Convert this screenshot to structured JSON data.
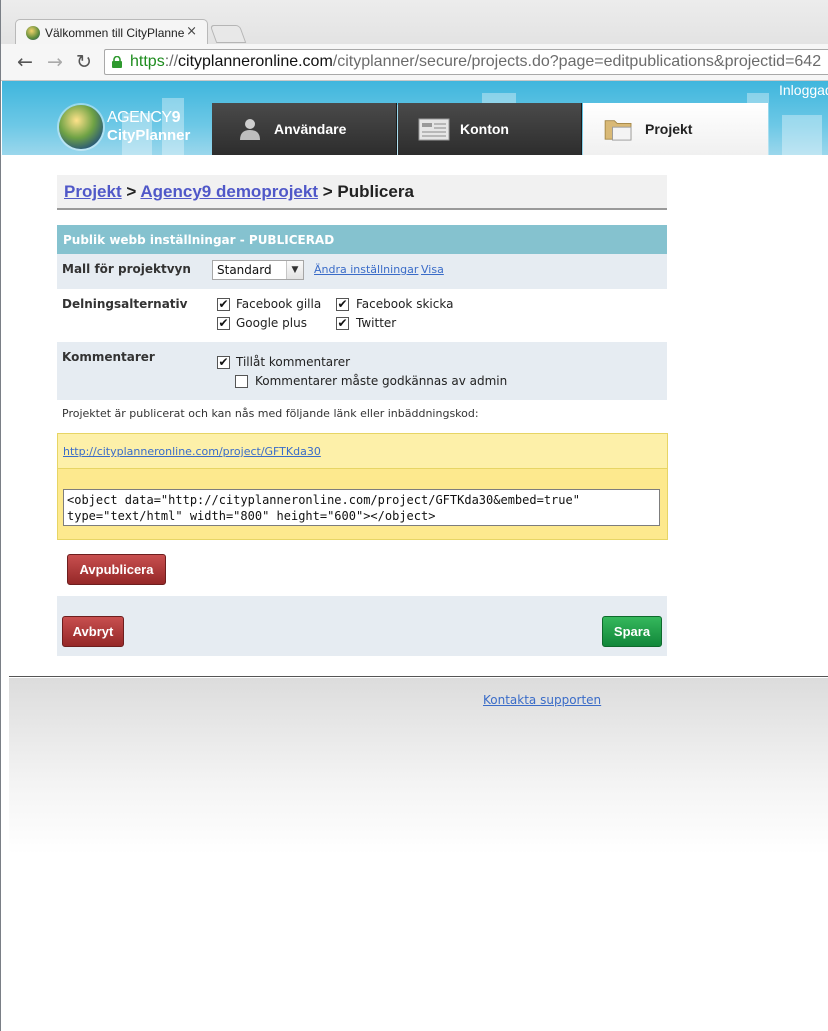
{
  "browser": {
    "tab_title": "Välkommen till CityPlanne",
    "tab_close": "×",
    "url_scheme": "https",
    "url_sep": "://",
    "url_host": "cityplanneronline.com",
    "url_path": "/cityplanner/secure/projects.do?page=editpublications&projectid=642",
    "back": "←",
    "forward": "→",
    "reload": "↻"
  },
  "header": {
    "logged_in": "Inloggad",
    "logo_line1_a": "AGENCY",
    "logo_line1_b": "9",
    "logo_line2": "CityPlanner",
    "tabs": [
      {
        "label": "Användare",
        "icon": "user-icon"
      },
      {
        "label": "Konton",
        "icon": "accounts-icon"
      },
      {
        "label": "Projekt",
        "icon": "folder-icon",
        "active": true
      }
    ]
  },
  "breadcrumb": {
    "item1": "Projekt",
    "sep": " > ",
    "item2": "Agency9 demoprojekt",
    "current": "Publicera"
  },
  "settings": {
    "title": "Publik webb inställningar - PUBLICERAD",
    "template_label": "Mall för projektvyn",
    "template_value": "Standard",
    "template_arrow": "▼",
    "change_settings_link": "Ändra inställningar",
    "view_link": "Visa",
    "sharing_label": "Delningsalternativ",
    "sharing": [
      {
        "label": "Facebook gilla",
        "checked": true
      },
      {
        "label": "Facebook skicka",
        "checked": true
      },
      {
        "label": "Google plus",
        "checked": true
      },
      {
        "label": "Twitter",
        "checked": true
      }
    ],
    "comments_label": "Kommentarer",
    "allow_comments": "Tillåt kommentarer",
    "approve_comments": "Kommentarer måste godkännas av admin",
    "checkmark": "✔"
  },
  "publish": {
    "info": "Projektet är publicerat och kan nås med följande länk eller inbäddningskod:",
    "link": "http://cityplanneronline.com/project/GFTKda30",
    "embed_code": "<object data=\"http://cityplanneronline.com/project/GFTKda30&embed=true\"\ntype=\"text/html\" width=\"800\" height=\"600\"></object>",
    "unpublish_button": "Avpublicera"
  },
  "actions": {
    "cancel_button": "Avbryt",
    "save_button": "Spara"
  },
  "footer": {
    "support_link": "Kontakta supporten"
  },
  "colors": {
    "header_blue": "#3fb6dd",
    "section_teal": "#85c2cf",
    "link_blue": "#3a6cc8",
    "danger_red": "#b03a3a",
    "save_green": "#1d9b45",
    "highlight_yellow": "#fdf0a9"
  }
}
